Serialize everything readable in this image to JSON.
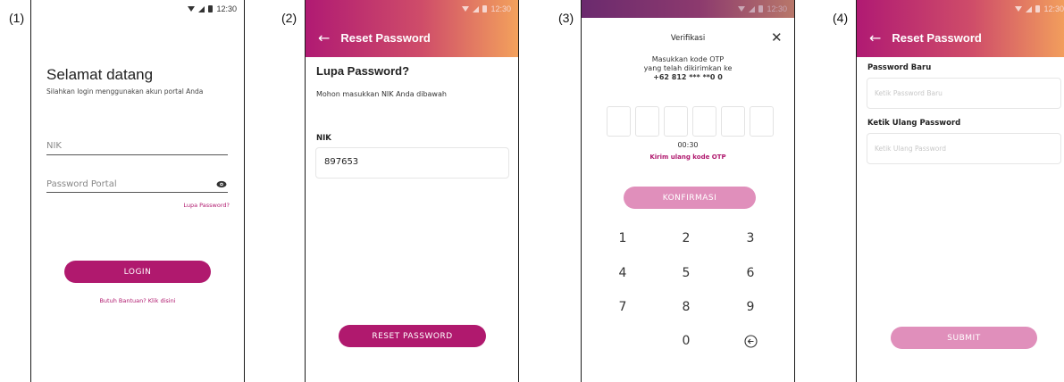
{
  "labels": [
    "(1)",
    "(2)",
    "(3)",
    "(4)"
  ],
  "time": "12:30",
  "screen1": {
    "title": "Selamat datang",
    "subtitle": "Silahkan login menggunakan akun portal Anda",
    "nik_placeholder": "NIK",
    "password_placeholder": "Password Portal",
    "forgot": "Lupa Password?",
    "login": "LOGIN",
    "help": "Butuh Bantuan? Klik disini"
  },
  "screen2": {
    "appbar": "Reset Password",
    "heading": "Lupa Password?",
    "instruction": "Mohon masukkan NIK Anda dibawah",
    "nik_label": "NIK",
    "nik_value": "897653",
    "button": "RESET PASSWORD"
  },
  "screen3": {
    "title": "Verifikasi",
    "line1": "Masukkan kode OTP",
    "line2": "yang telah dikirimkan ke",
    "phone": "+62 812 *** **0 0",
    "timer": "00:30",
    "resend": "Kirim ulang kode OTP",
    "button": "KONFIRMASI",
    "keys": [
      "1",
      "2",
      "3",
      "4",
      "5",
      "6",
      "7",
      "8",
      "9",
      "0"
    ]
  },
  "screen4": {
    "appbar": "Reset Password",
    "new_label": "Password Baru",
    "new_placeholder": "Ketik Password Baru",
    "retype_label": "Ketik Ulang Password",
    "retype_placeholder": "Ketik Ulang Password",
    "button": "SUBMIT"
  },
  "colors": {
    "primary": "#b0196e",
    "primary_light": "#e08fbb",
    "gradient_end": "#f3a15c"
  },
  "icons": {
    "back": "arrow-left-icon",
    "close": "close-icon",
    "eye": "eye-icon",
    "backspace": "backspace-icon"
  }
}
